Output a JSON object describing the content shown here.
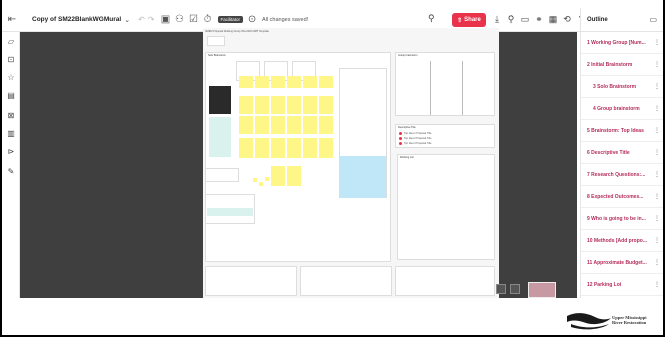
{
  "header": {
    "board_title": "Copy of SM22BlankWGMural",
    "facilitator_badge": "Facilitator",
    "save_status": "All changes saved!",
    "share_label": "Share"
  },
  "board": {
    "title": "SMEM Proposal Working Group WG-2022 MMT Template",
    "sections": {
      "solo_brainstorm": "Solo Brainstorm",
      "group_brainstorm": "Group brainstorm",
      "descriptive_title": "Descriptive Title",
      "working_list": "Working List"
    },
    "proposal_titles": [
      "Top Idea 1 Proposal Title",
      "Top Idea 2 Proposal Title",
      "Top Idea 3 Proposal Title"
    ]
  },
  "outline": {
    "heading": "Outline",
    "items": [
      {
        "label": "1 Working Group [Num..."
      },
      {
        "label": "2 Initial Brainstorm"
      },
      {
        "label": "3 Solo Brainstorm"
      },
      {
        "label": "4 Group brainstorm"
      },
      {
        "label": "5 Brainstorm: Top Ideas"
      },
      {
        "label": "6 Descriptive Title"
      },
      {
        "label": "7 Research Questions:..."
      },
      {
        "label": "8 Expected Outcomes..."
      },
      {
        "label": "9 Who is going to be in..."
      },
      {
        "label": "10 Methods [Add propo..."
      },
      {
        "label": "11 Approximate Budget..."
      },
      {
        "label": "12 Parking Lot"
      }
    ]
  },
  "logo": {
    "line1": "Upper Mississippi",
    "line2": "River Restoration"
  },
  "colors": {
    "accent": "#e8334b",
    "outline_text": "#b52d5a",
    "canvas": "#3f3f3f"
  }
}
